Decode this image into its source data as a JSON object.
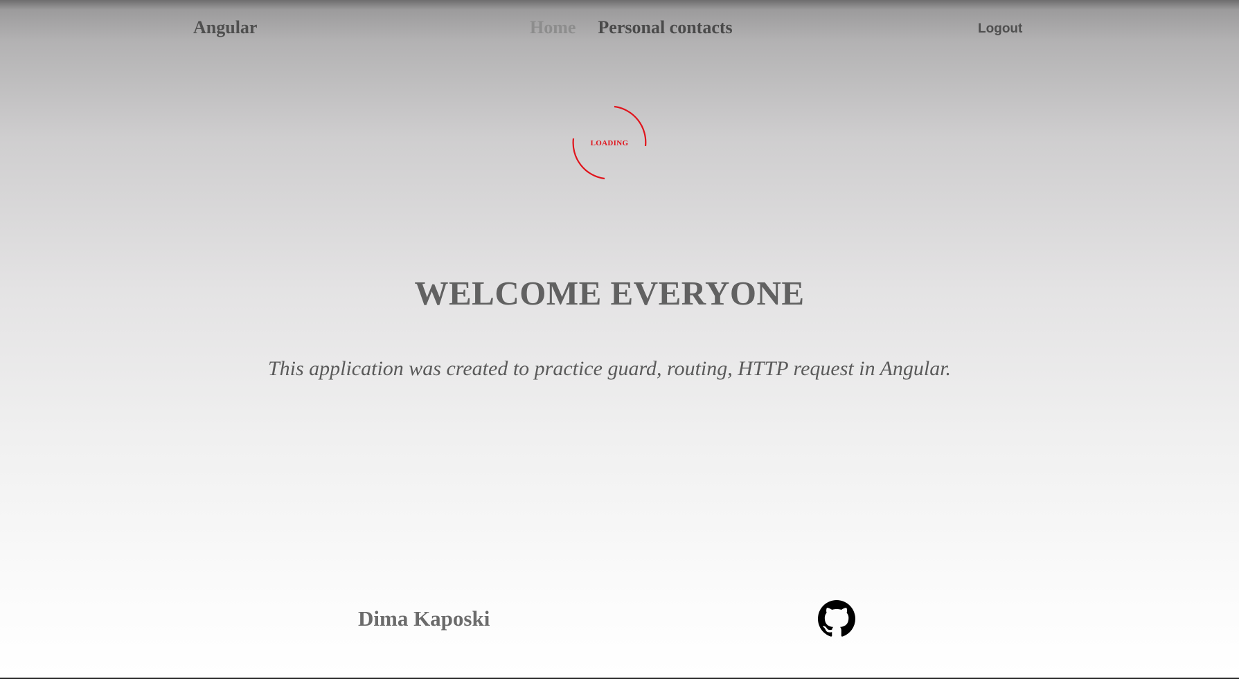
{
  "navbar": {
    "brand": "Angular",
    "links": [
      {
        "label": "Home",
        "active": true
      },
      {
        "label": "Personal contacts",
        "active": false
      }
    ],
    "logout_label": "Logout"
  },
  "loader": {
    "text": "LOADING",
    "color": "#e0141c"
  },
  "main": {
    "title": "WELCOME EVERYONE",
    "subtitle": "This application was created to practice guard, routing, HTTP request in Angular."
  },
  "footer": {
    "author": "Dima Kaposki",
    "icon": "github-icon"
  }
}
